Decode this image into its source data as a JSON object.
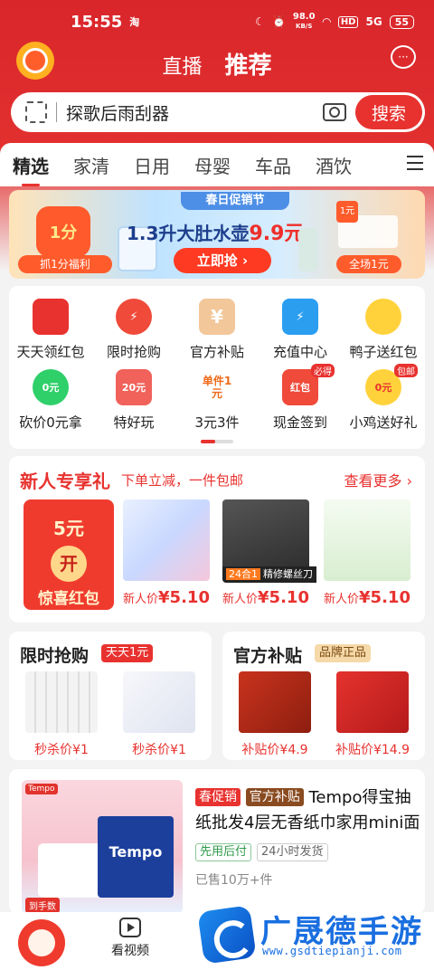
{
  "status_bar": {
    "time": "15:55",
    "app_glyph": "淘",
    "network_speed": "98.0",
    "speed_unit": "KB/S",
    "hd": "HD",
    "signal": "5G",
    "battery": "55"
  },
  "header": {
    "tabs": [
      "直播",
      "推荐"
    ],
    "active_tab": "推荐"
  },
  "search": {
    "query": "探歌后雨刮器",
    "button": "搜索"
  },
  "categories": [
    "精选",
    "家清",
    "日用",
    "母婴",
    "车品",
    "酒饮"
  ],
  "banner": {
    "left_tag": "1分",
    "left_label": "抓1分福利",
    "festival": "春日促销节",
    "headline": "1.3升大肚水壶",
    "headline_price": "9.9元",
    "cta": "立即抢",
    "right_tag": "1元",
    "right_label": "全场1元"
  },
  "quick_grid": {
    "row1": [
      {
        "label": "天天领红包",
        "icon": "red-envelope-icon",
        "color": "#e8322f",
        "glyph": ""
      },
      {
        "label": "限时抢购",
        "icon": "alarm-clock-icon",
        "color": "#ef4a3a",
        "glyph": ""
      },
      {
        "label": "官方补贴",
        "icon": "yen-ticket-icon",
        "color": "#f2c79a",
        "glyph": "¥"
      },
      {
        "label": "充值中心",
        "icon": "phone-charge-icon",
        "color": "#2b9ef0",
        "glyph": ""
      },
      {
        "label": "鸭子送红包",
        "icon": "duck-icon",
        "color": "#ffd23c",
        "glyph": ""
      }
    ],
    "row2": [
      {
        "label": "砍价0元拿",
        "icon": "zero-yuan-icon",
        "color": "#2fcf6a",
        "glyph": "0元"
      },
      {
        "label": "特好玩",
        "icon": "coupon-20-icon",
        "color": "#f0625a",
        "glyph": "20元"
      },
      {
        "label": "3元3件",
        "icon": "single-1yuan-icon",
        "color": "#ffffff",
        "glyph": "单件1元"
      },
      {
        "label": "现金签到",
        "icon": "cash-redpack-icon",
        "color": "#ef4a3a",
        "glyph": "红包",
        "badge": "必得"
      },
      {
        "label": "小鸡送好礼",
        "icon": "chick-icon",
        "color": "#ffd23c",
        "glyph": "0元",
        "badge": "包邮"
      }
    ]
  },
  "new_user": {
    "title": "新人专享礼",
    "subtitle": "下单立减，一件包邮",
    "more": "查看更多",
    "redpack_amount": "5元",
    "redpack_open": "开",
    "redpack_label": "惊喜红包",
    "products": [
      {
        "price_label": "新人价",
        "price": "¥5.10"
      },
      {
        "price_label": "新人价",
        "price": "¥5.10",
        "tag_prefix": "24合1",
        "tag": "精修螺丝刀"
      },
      {
        "price_label": "新人价",
        "price": "¥5.10"
      }
    ]
  },
  "flash_sale": {
    "title": "限时抢购",
    "badge": "天天1元",
    "items": [
      {
        "price": "秒杀价¥1"
      },
      {
        "price": "秒杀价¥1"
      }
    ]
  },
  "subsidy": {
    "title": "官方补贴",
    "badge": "品牌正品",
    "items": [
      {
        "price": "补贴价¥4.9"
      },
      {
        "price": "补贴价¥14.9"
      }
    ]
  },
  "feed_item": {
    "tag1": "春促销",
    "tag2": "官方补贴",
    "title": "Tempo得宝抽纸批发4层无香纸巾家用mini面",
    "tag_green": "先用后付",
    "tag_gray": "24小时发货",
    "sold": "已售10万+件",
    "image_brand": "Tempo",
    "image_pack": "Tempo",
    "image_corner": "到手数"
  },
  "bottom_nav": {
    "video": "看视频"
  },
  "watermark": {
    "title": "广晟德手游",
    "url": "www.gsdtiepianji.com"
  },
  "colors": {
    "brand_red": "#e8322f",
    "header_red": "#d9262b"
  }
}
